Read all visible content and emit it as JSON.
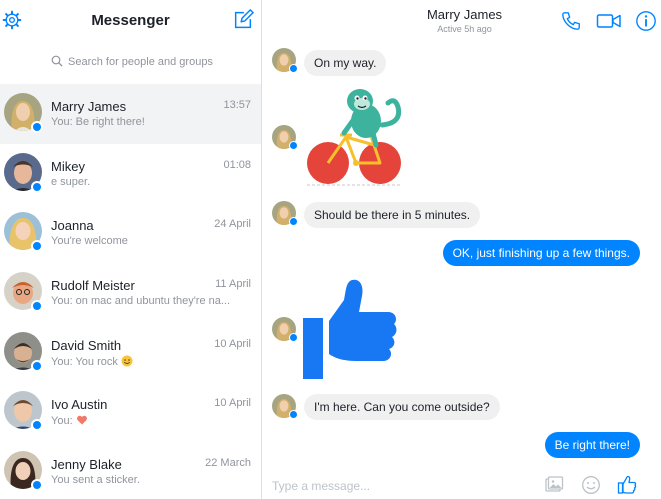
{
  "sidebar": {
    "title": "Messenger",
    "search_placeholder": "Search for people and groups",
    "conversations": [
      {
        "name": "Marry James",
        "time": "13:57",
        "preview": "You: Be right there!",
        "active": true
      },
      {
        "name": "Mikey",
        "time": "01:08",
        "preview": "e super."
      },
      {
        "name": "Joanna",
        "time": "24 April",
        "preview": "You're welcome"
      },
      {
        "name": "Rudolf Meister",
        "time": "11 April",
        "preview": "You: on mac and ubuntu they're na..."
      },
      {
        "name": "David Smith",
        "time": "10 April",
        "preview": "You: You rock",
        "emoji": "smile-emoji"
      },
      {
        "name": "Ivo Austin",
        "time": "10 April",
        "preview": "You:",
        "emoji": "heart-emoji"
      },
      {
        "name": "Jenny Blake",
        "time": "22 March",
        "preview": "You sent a sticker."
      }
    ]
  },
  "chat": {
    "contact_name": "Marry James",
    "status": "Active 5h ago",
    "messages": [
      {
        "from": "them",
        "type": "text",
        "text": "On my way."
      },
      {
        "from": "them",
        "type": "sticker",
        "sticker": "monkey-bicycle-sticker"
      },
      {
        "from": "them",
        "type": "text",
        "text": "Should be there in 5 minutes."
      },
      {
        "from": "me",
        "type": "text",
        "text": "OK, just finishing up a few things."
      },
      {
        "from": "them",
        "type": "sticker",
        "sticker": "thumbs-up-sticker"
      },
      {
        "from": "them",
        "type": "text",
        "text": "I'm here. Can you come outside?"
      },
      {
        "from": "me",
        "type": "text",
        "text": "Be right there!"
      }
    ],
    "composer_placeholder": "Type a message..."
  },
  "icons": {
    "settings": "gear-icon",
    "compose": "compose-icon",
    "search": "search-icon",
    "call": "phone-icon",
    "video": "video-camera-icon",
    "info": "info-icon",
    "photo": "photo-icon",
    "emoji": "emoji-icon",
    "like": "thumbs-up-icon"
  },
  "colors": {
    "accent": "#0084ff",
    "incoming_bubble": "#f1f0f0",
    "active_row": "#f2f3f5",
    "secondary_text": "#90949c",
    "sticker_monkey": "#3db39e",
    "sticker_wheel": "#e5443b",
    "sticker_frame": "#f7c02b"
  }
}
